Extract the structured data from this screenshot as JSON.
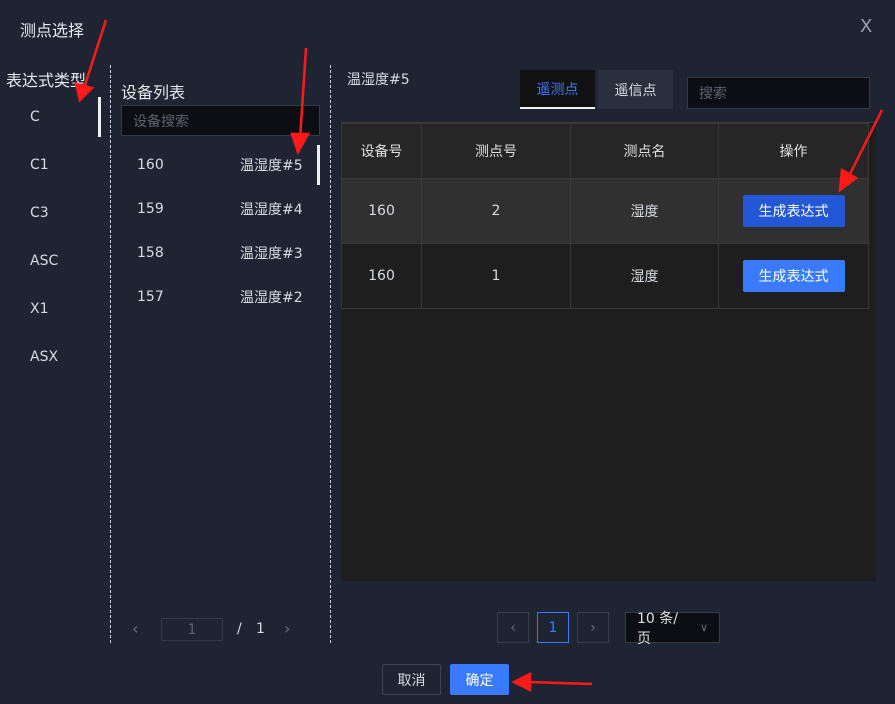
{
  "dialog": {
    "title": "测点选择",
    "close": "X"
  },
  "types": {
    "heading": "表达式类型",
    "items": [
      "C",
      "C1",
      "C3",
      "ASC",
      "X1",
      "ASX"
    ],
    "active": "C"
  },
  "devices": {
    "heading": "设备列表",
    "search_placeholder": "设备搜索",
    "items": [
      {
        "id": "160",
        "name": "温湿度#5"
      },
      {
        "id": "159",
        "name": "温湿度#4"
      },
      {
        "id": "158",
        "name": "温湿度#3"
      },
      {
        "id": "157",
        "name": "温湿度#2"
      }
    ],
    "pager": {
      "prev": "‹",
      "page": "1",
      "sep": "/",
      "total": "1",
      "next": "›"
    }
  },
  "points": {
    "heading": "温湿度#5",
    "tabs": [
      "遥测点",
      "遥信点"
    ],
    "search_placeholder": "搜索",
    "columns": [
      "设备号",
      "测点号",
      "测点名",
      "操作"
    ],
    "rows": [
      {
        "device": "160",
        "point": "2",
        "name": "湿度",
        "action": "生成表达式"
      },
      {
        "device": "160",
        "point": "1",
        "name": "湿度",
        "action": "生成表达式"
      }
    ],
    "pager": {
      "prev": "‹",
      "page": "1",
      "next": "›",
      "size": "10 条/页"
    }
  },
  "footer": {
    "cancel": "取消",
    "ok": "确定"
  },
  "colors": {
    "accent": "#3a7afe",
    "bg": "#1f2433",
    "annotation": "#ff1a1a"
  }
}
